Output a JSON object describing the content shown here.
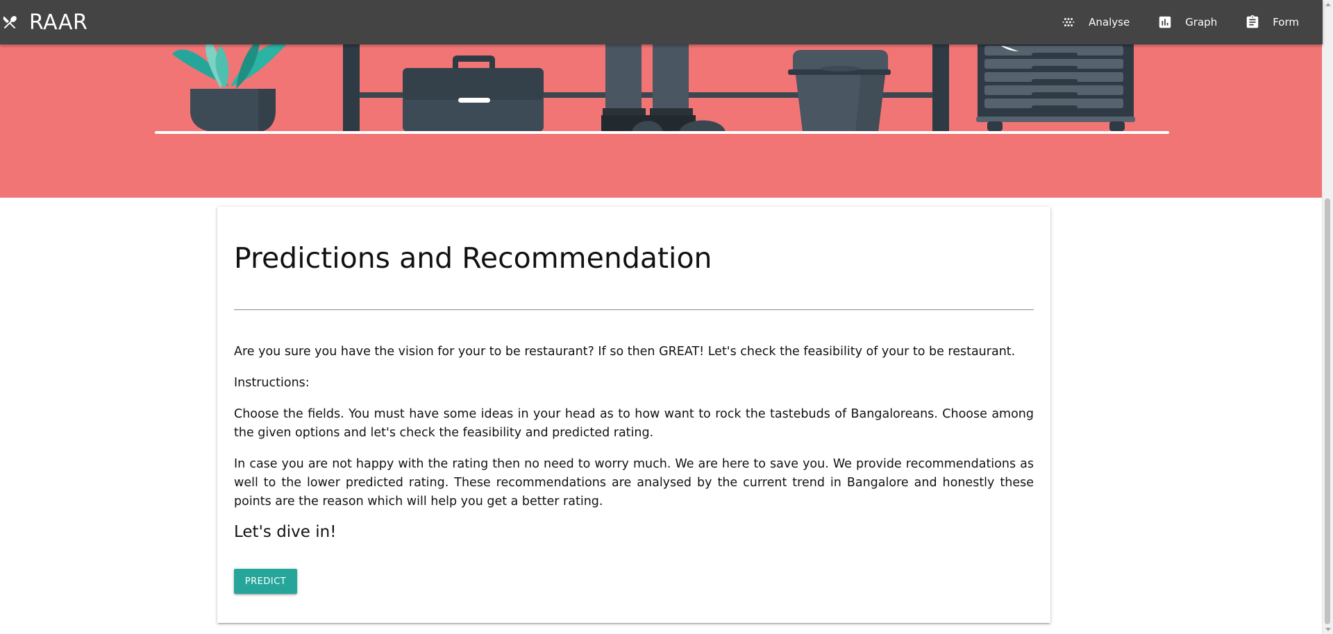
{
  "navbar": {
    "brand": "RAAR",
    "brand_icon": "fork-knife-icon",
    "links": [
      {
        "label": "Analyse",
        "icon": "scatter-dots-icon"
      },
      {
        "label": "Graph",
        "icon": "bar-chart-icon"
      },
      {
        "label": "Form",
        "icon": "clipboard-icon"
      }
    ],
    "background": "#444444"
  },
  "hero": {
    "background": "#f27575",
    "illustration": "office-shelf-illustration"
  },
  "card": {
    "title": "Predictions and Recommendation",
    "paragraphs": [
      "Are you sure you have the vision for your to be restaurant? If so then GREAT! Let's check the feasibility of your to be restaurant.",
      "Instructions:",
      "Choose the fields. You must have some ideas in your head as to how want to rock the tastebuds of Bangaloreans. Choose among the given options and let's check the feasibility and predicted rating.",
      "In case you are not happy with the rating then no need to worry much. We are here to save you. We provide recommendations as well to the lower predicted rating. These recommendations are analysed by the current trend in Bangalore and honestly these points are the reason which will help you get a better rating."
    ],
    "subheading": "Let's dive in!",
    "predict_button": "PREDICT",
    "button_color": "#26a69a"
  }
}
